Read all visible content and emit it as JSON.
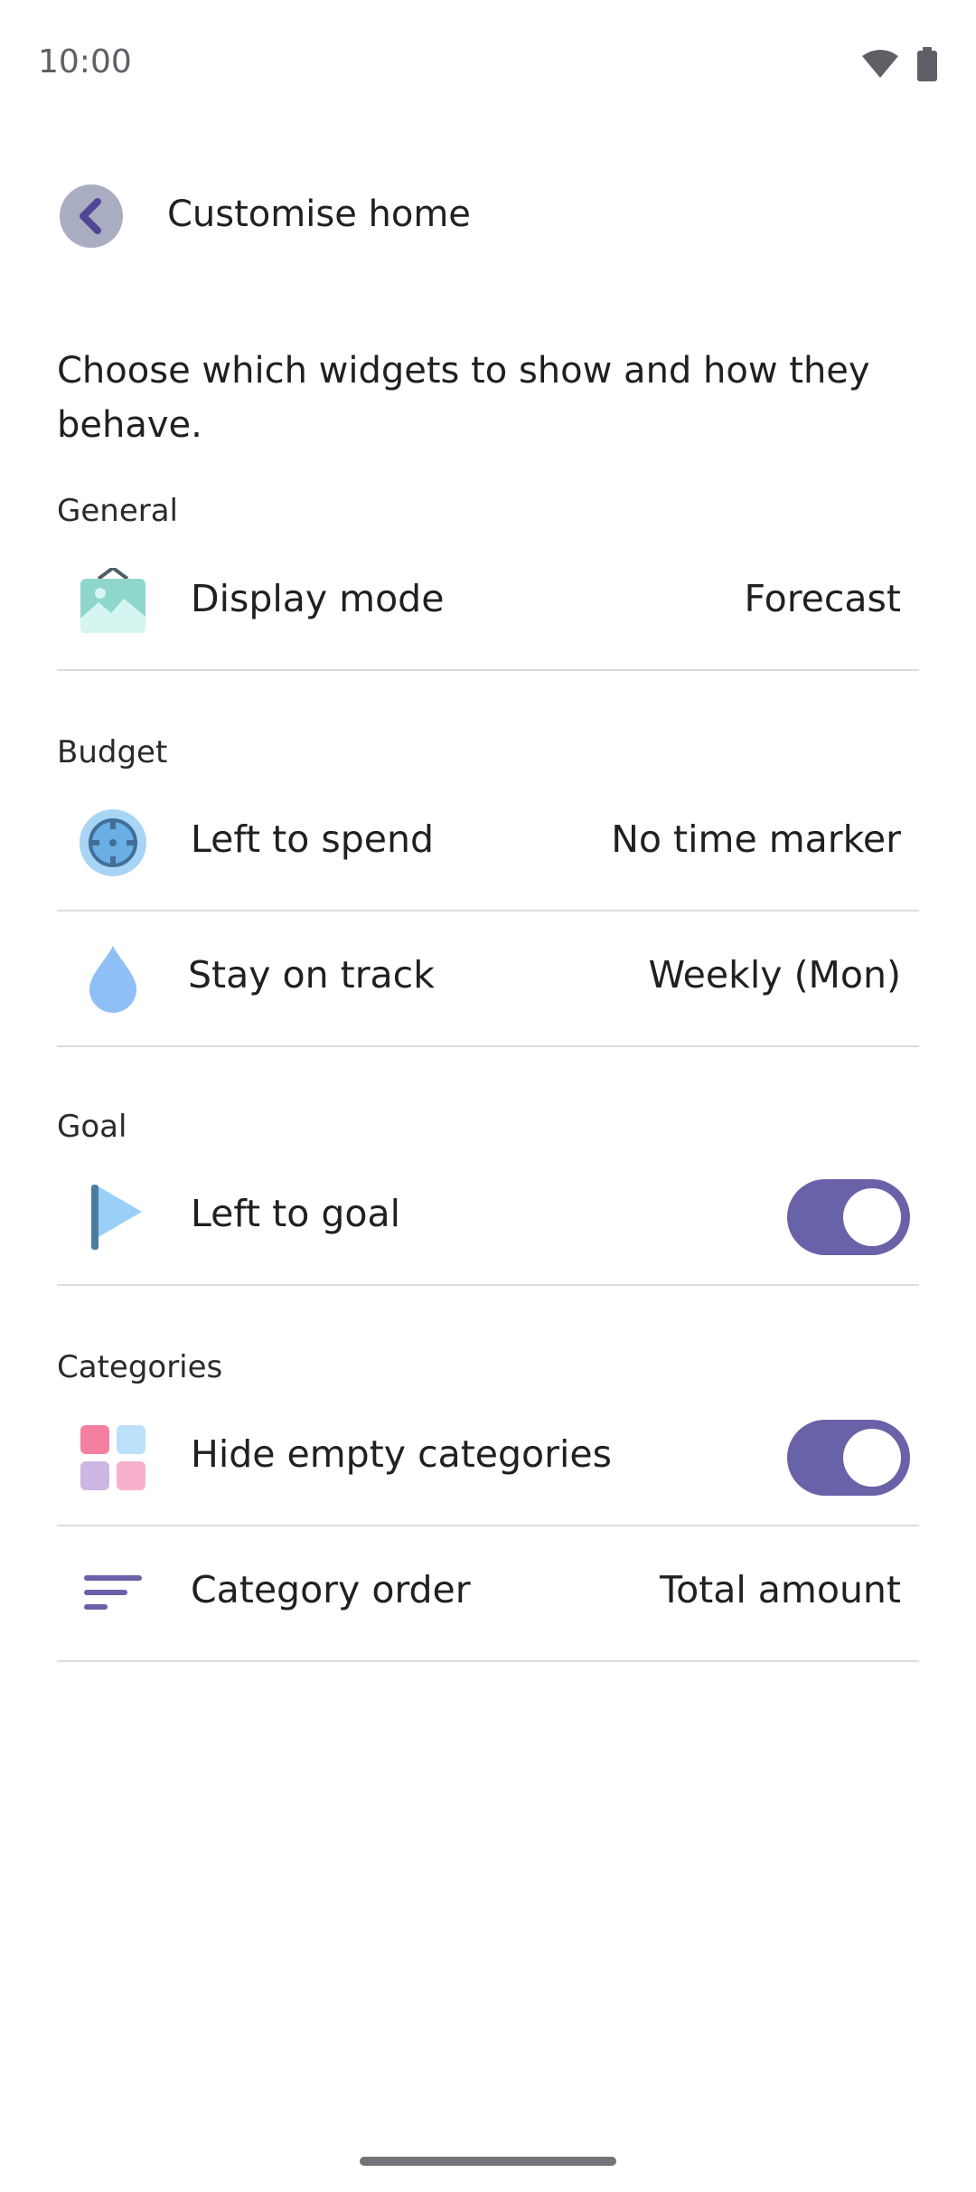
{
  "status_bar": {
    "time": "10:00"
  },
  "header": {
    "title": "Customise home"
  },
  "intro": "Choose which widgets to show and how they behave.",
  "sections": {
    "general": {
      "label": "General",
      "display_mode": {
        "label": "Display mode",
        "value": "Forecast"
      }
    },
    "budget": {
      "label": "Budget",
      "left_to_spend": {
        "label": "Left to spend",
        "value": "No time marker"
      },
      "stay_on_track": {
        "label": "Stay on track",
        "value": "Weekly (Mon)"
      }
    },
    "goal": {
      "label": "Goal",
      "left_to_goal": {
        "label": "Left to goal",
        "enabled": true
      }
    },
    "categories": {
      "label": "Categories",
      "hide_empty": {
        "label": "Hide empty categories",
        "enabled": true
      },
      "category_order": {
        "label": "Category order",
        "value": "Total amount"
      }
    }
  },
  "colors": {
    "accent": "#6a62a8",
    "divider": "#dcdce0",
    "back_button": "#a9adc2"
  },
  "icons": [
    "wifi-icon",
    "battery-icon",
    "back-chevron-icon",
    "picture-frame-icon",
    "target-icon",
    "water-drop-icon",
    "flag-icon",
    "category-grid-icon",
    "sort-lines-icon"
  ]
}
